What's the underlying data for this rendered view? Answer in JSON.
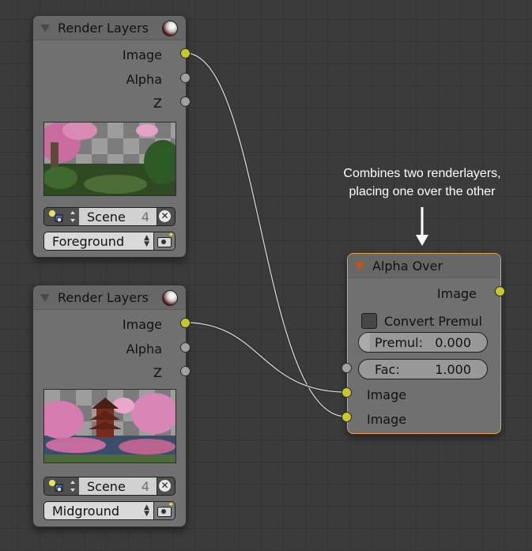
{
  "nodes": {
    "render_layers_1": {
      "title": "Render Layers",
      "outputs": [
        "Image",
        "Alpha",
        "Z"
      ],
      "scene": {
        "label": "Scene",
        "users": "4"
      },
      "layer": "Foreground"
    },
    "render_layers_2": {
      "title": "Render Layers",
      "outputs": [
        "Image",
        "Alpha",
        "Z"
      ],
      "scene": {
        "label": "Scene",
        "users": "4"
      },
      "layer": "Midground"
    },
    "alpha_over": {
      "title": "Alpha Over",
      "output": "Image",
      "convert_premul": {
        "label": "Convert Premul",
        "checked": false
      },
      "premul": {
        "label": "Premul:",
        "value": "0.000",
        "fraction": 0.0
      },
      "fac": {
        "label": "Fac:",
        "value": "1.000",
        "fraction": 1.0
      },
      "inputs": [
        "Image",
        "Image"
      ]
    }
  },
  "annotation": {
    "line1": "Combines two renderlayers,",
    "line2": "placing one over the other"
  },
  "colors": {
    "socket_color": "#c7c729",
    "socket_value": "#a1a1a1",
    "selected_border": "#e6a34a",
    "collapse_arrow_active": "#c2551a",
    "background": "#3b3b3b"
  },
  "icons": {
    "preview": "material-sphere-icon",
    "scene": "scene-icon",
    "close": "close-icon",
    "render": "camera-render-icon"
  }
}
